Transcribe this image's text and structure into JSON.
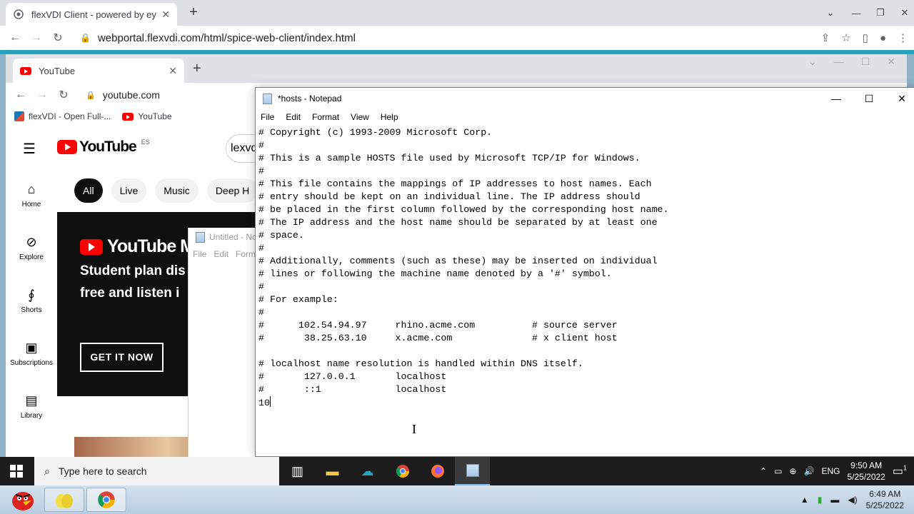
{
  "outer_browser": {
    "tab_title": "flexVDI Client - powered by ey",
    "url": "webportal.flexvdi.com/html/spice-web-client/index.html"
  },
  "inner_browser": {
    "tab_title": "YouTube",
    "url": "youtube.com",
    "bookmarks": [
      "flexVDI - Open Full-...",
      "YouTube"
    ]
  },
  "youtube": {
    "logo_text": "YouTube",
    "region": "ES",
    "search_value": "lexvd",
    "chips": [
      "All",
      "Live",
      "Music",
      "Deep H"
    ],
    "sidebar": [
      {
        "label": "Home",
        "icon": "home-icon"
      },
      {
        "label": "Explore",
        "icon": "compass-icon"
      },
      {
        "label": "Shorts",
        "icon": "shorts-icon"
      },
      {
        "label": "Subscriptions",
        "icon": "subscriptions-icon"
      },
      {
        "label": "Library",
        "icon": "library-icon"
      }
    ],
    "banner": {
      "logo_text": "YouTube Musi",
      "line1": "Student plan dis",
      "line2": "free and listen i",
      "cta": "GET IT NOW"
    }
  },
  "untitled_notepad": {
    "title": "Untitled - No",
    "menu": [
      "File",
      "Edit",
      "Form"
    ]
  },
  "hosts_notepad": {
    "title": "*hosts - Notepad",
    "menu": [
      "File",
      "Edit",
      "Format",
      "View",
      "Help"
    ],
    "lines": [
      "# Copyright (c) 1993-2009 Microsoft Corp.",
      "#",
      "# This is a sample HOSTS file used by Microsoft TCP/IP for Windows.",
      "#",
      "# This file contains the mappings of IP addresses to host names. Each",
      "# entry should be kept on an individual line. The IP address should",
      "# be placed in the first column followed by the corresponding host name.",
      "# The IP address and the host name should be separated by at least one",
      "# space.",
      "#",
      "# Additionally, comments (such as these) may be inserted on individual",
      "# lines or following the machine name denoted by a '#' symbol.",
      "#",
      "# For example:",
      "#",
      "#      102.54.94.97     rhino.acme.com          # source server",
      "#       38.25.63.10     x.acme.com              # x client host",
      "",
      "# localhost name resolution is handled within DNS itself.",
      "#       127.0.0.1       localhost",
      "#       ::1             localhost"
    ],
    "current_line": "10"
  },
  "inner_taskbar": {
    "search_placeholder": "Type here to search",
    "language": "ENG",
    "time": "9:50 AM",
    "date": "5/25/2022",
    "notification_count": "1"
  },
  "outer_taskbar": {
    "time": "6:49 AM",
    "date": "5/25/2022"
  },
  "colors": {
    "accent_teal": "#27a4bd",
    "youtube_red": "#ff0000"
  }
}
